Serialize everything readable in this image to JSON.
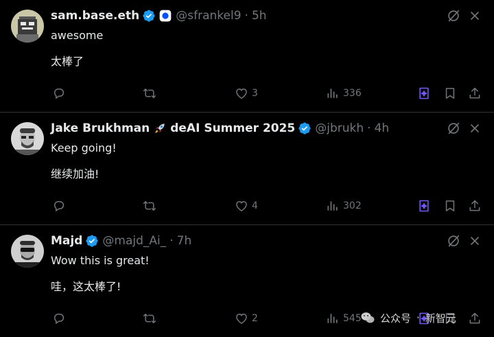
{
  "colors": {
    "background": "#000000",
    "text": "#e7e9ea",
    "muted": "#71767b",
    "verified": "#1d9bf0",
    "grok": "#7856ff",
    "divider": "#2f3336"
  },
  "tweets": [
    {
      "name": "sam.base.eth",
      "badges": [
        "verified-icon",
        "base-app-icon"
      ],
      "handle": "@sfrankel9",
      "dot": "·",
      "time": "5h",
      "text_en": "awesome",
      "text_zh": "太棒了",
      "likes": "3",
      "views": "336"
    },
    {
      "name": "Jake Brukhman",
      "name_emoji": "rocket-icon",
      "name_suffix": "deAI Summer 2025",
      "handle": "@jbrukh",
      "dot": "·",
      "time": "4h",
      "text_en": "Keep going!",
      "text_zh": "继续加油!",
      "likes": "4",
      "views": "302"
    },
    {
      "name": "Majd",
      "handle": "@majd_Ai_",
      "dot": "·",
      "time": "7h",
      "text_en": "Wow this is great!",
      "text_zh": "哇，这太棒了!",
      "likes": "2",
      "views": "545"
    }
  ],
  "watermark": {
    "left": "公众号",
    "sep": "·",
    "right": "新智元"
  }
}
